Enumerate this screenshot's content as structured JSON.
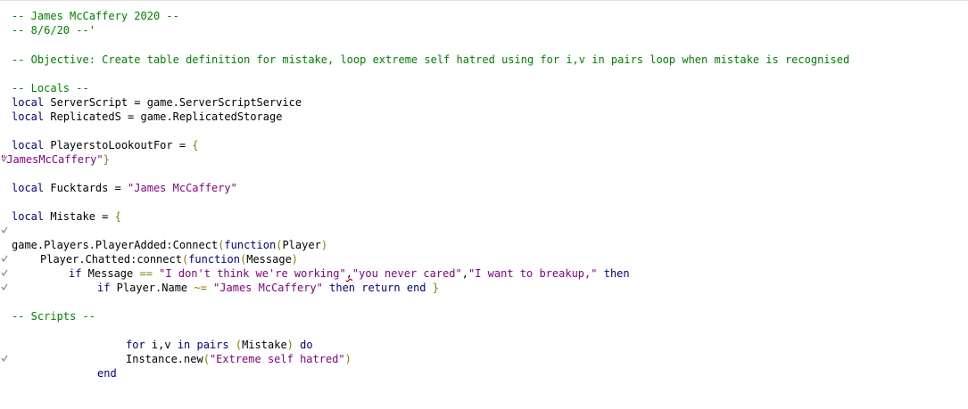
{
  "editor": {
    "lines": {
      "l1": "-- James McCaffery 2020 --",
      "l2": "-- 8/6/20 --'",
      "l3": "-- Objective: Create table definition for mistake, loop extreme self hatred using for i,v in pairs loop when mistake is recognised",
      "l4": "-- Locals --",
      "l5": {
        "kw": "local",
        "rest": " ServerScript = game.ServerScriptService"
      },
      "l6": {
        "kw": "local",
        "rest": " ReplicatedS = game.ReplicatedStorage"
      },
      "l7": {
        "kw": "local",
        "rest": " PlayerstoLookoutFor = ",
        "brace": "{"
      },
      "l8": {
        "str": "\"JamesMcCaffery\"",
        "brace": "}"
      },
      "l9": {
        "kw": "local",
        "rest": " Fucktards = ",
        "str": "\"James McCaffery\""
      },
      "l10": {
        "kw": "local",
        "rest": " Mistake = ",
        "brace": "{"
      },
      "l11": {
        "a": "game.Players.PlayerAdded:Connect",
        "p1": "(",
        "kw": "function",
        "p2": "(",
        "arg": "Player",
        "p3": ")"
      },
      "l12": {
        "a": "Player.Chatted:connect",
        "p1": "(",
        "kw": "function",
        "p2": "(",
        "arg": "Message",
        "p3": ")"
      },
      "l13": {
        "kw1": "if",
        "a": " Message ",
        "op": "==",
        "s1": "\"I don't think we're working\"",
        "c1": ",",
        "s2": "\"you never cared\"",
        "c2": ",",
        "s3": "\"I want to breakup,\"",
        "kw2": "then"
      },
      "l14": {
        "kw1": "if",
        "a": " Player.Name ",
        "op": "~=",
        "s1": "\"James McCaffery\"",
        "kw2": "then",
        "kw3": "return",
        "kw4": "end",
        "brace": "}"
      },
      "l15": "-- Scripts --",
      "l16": {
        "kw1": "for",
        "a": " i,v ",
        "kw2": "in",
        "kw3": "pairs",
        "p1": "(",
        "arg": "Mistake",
        "p2": ")",
        "kw4": "do"
      },
      "l17": {
        "a": "Instance.new",
        "p1": "(",
        "s": "\"Extreme self hatred\"",
        "p2": ")"
      },
      "l18": {
        "kw": "end"
      }
    }
  }
}
